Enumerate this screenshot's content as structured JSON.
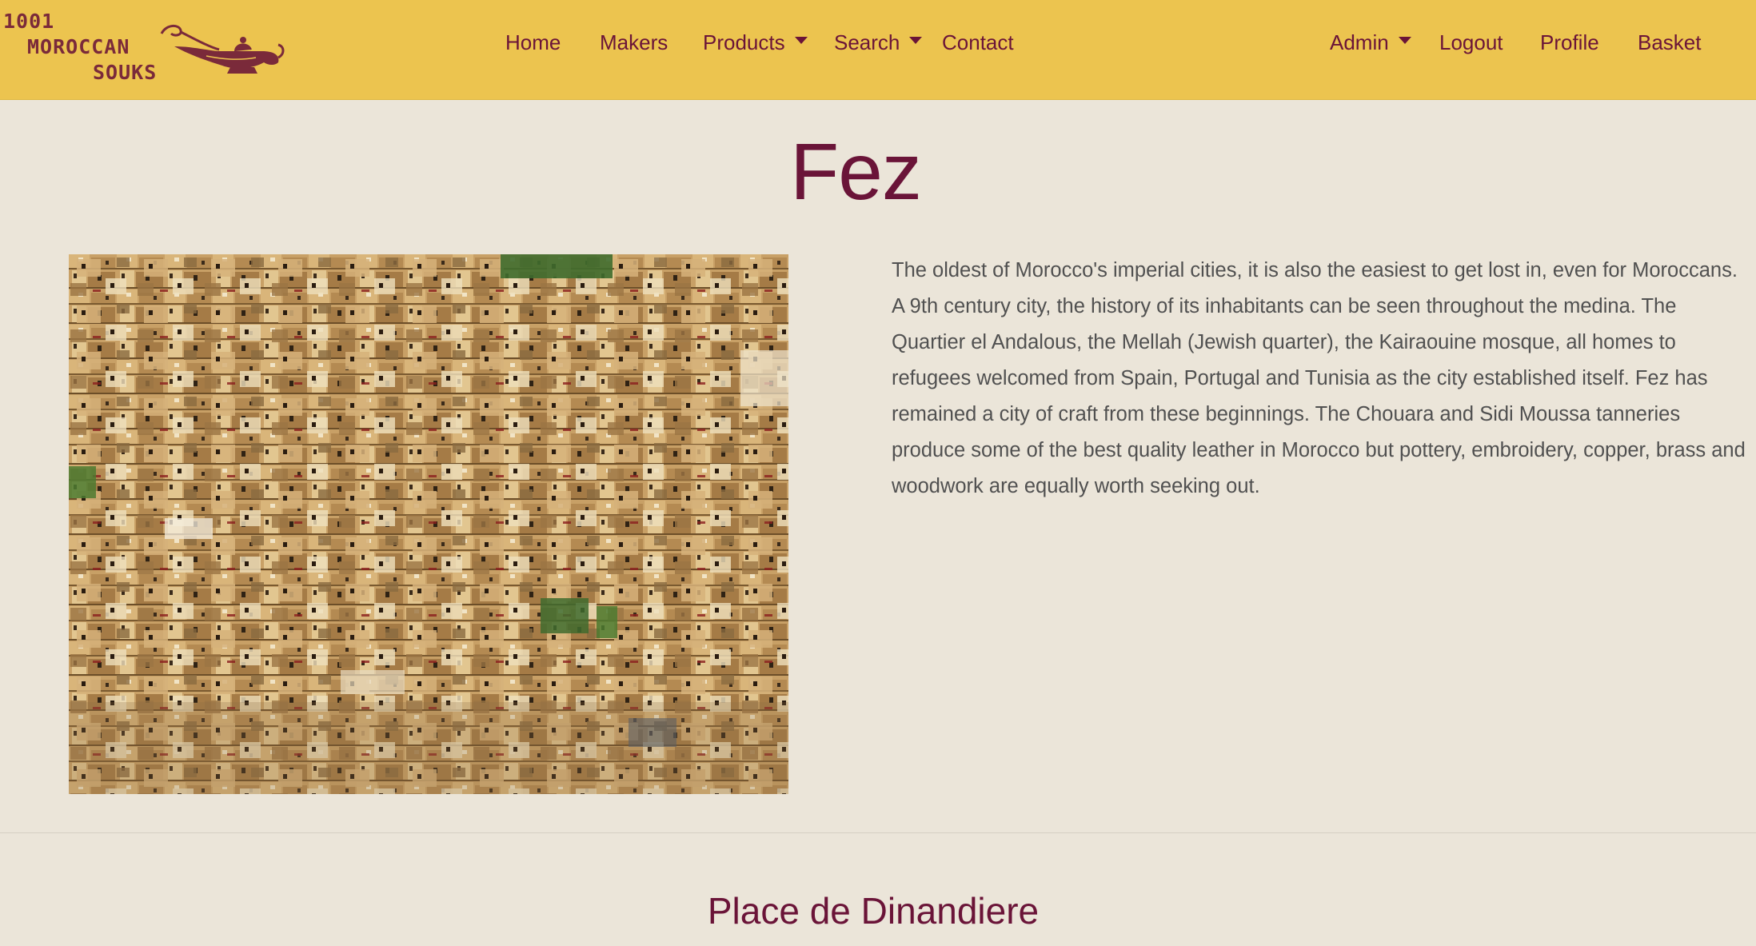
{
  "brand": {
    "logo_line1": "1001",
    "logo_line2": "MOROCCAN",
    "logo_line3": "SOUKS"
  },
  "nav": {
    "left": [
      {
        "label": "Home"
      },
      {
        "label": "Makers"
      },
      {
        "label": "Products",
        "dropdown": true
      },
      {
        "label": "Search",
        "dropdown": true
      },
      {
        "label": "Contact"
      }
    ],
    "right": [
      {
        "label": "Admin",
        "dropdown": true
      },
      {
        "label": "Logout"
      },
      {
        "label": "Profile"
      },
      {
        "label": "Basket"
      }
    ]
  },
  "page": {
    "title": "Fez",
    "description": "The oldest of Morocco's imperial cities, it is also the easiest to get lost in, even for Moroccans. A 9th century city, the history of its inhabitants can be seen throughout the medina. The Quartier el Andalous, the Mellah (Jewish quarter), the Kairaouine mosque, all homes to refugees welcomed from Spain, Portugal and Tunisia as the city established itself. Fez has remained a city of craft from these beginnings. The Chouara and Sidi Moussa tanneries produce some of the best quality leather in Morocco but pottery, embroidery, copper, brass and woodwork are equally worth seeking out."
  },
  "section": {
    "title": "Place de Dinandiere"
  },
  "colors": {
    "navbar": "#ecc44f",
    "accent": "#6a1438",
    "background": "#ebe5d9",
    "body_text": "#505050"
  },
  "icons": {
    "logo_lamp": "oil-lamp-icon",
    "dropdown": "caret-down-icon"
  }
}
